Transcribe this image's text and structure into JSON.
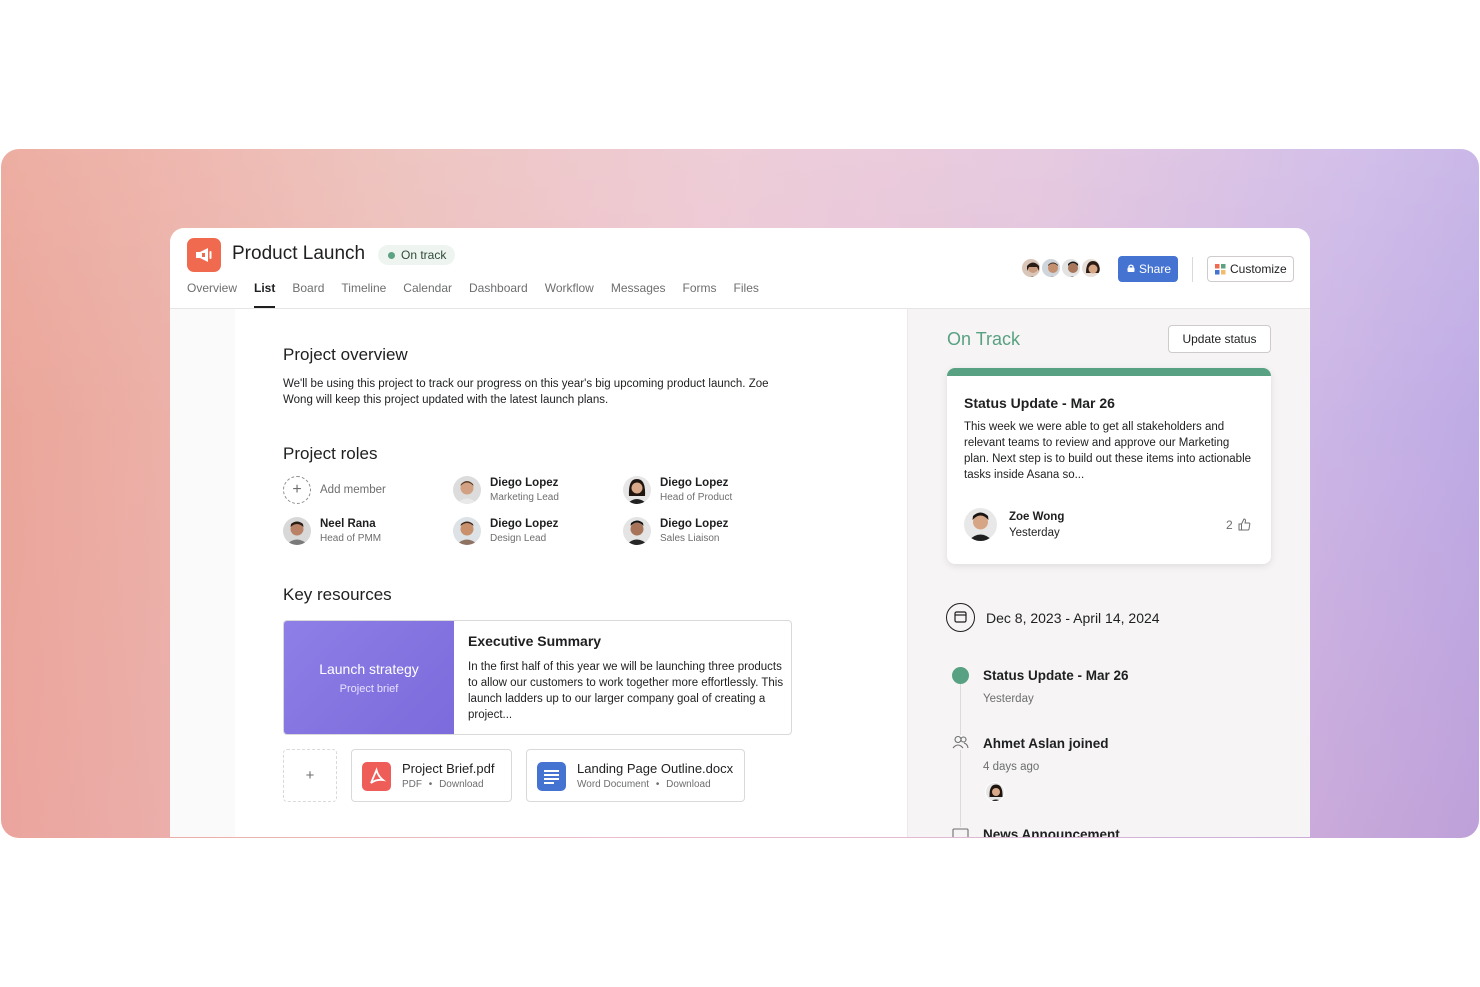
{
  "project": {
    "title": "Product Launch",
    "status": "On track",
    "icon": "megaphone-icon",
    "accent_color": "#f06a4f"
  },
  "tabs": [
    {
      "label": "Overview",
      "active": false
    },
    {
      "label": "List",
      "active": true
    },
    {
      "label": "Board",
      "active": false
    },
    {
      "label": "Timeline",
      "active": false
    },
    {
      "label": "Calendar",
      "active": false
    },
    {
      "label": "Dashboard",
      "active": false
    },
    {
      "label": "Workflow",
      "active": false
    },
    {
      "label": "Messages",
      "active": false
    },
    {
      "label": "Forms",
      "active": false
    },
    {
      "label": "Files",
      "active": false
    }
  ],
  "header": {
    "share_label": "Share",
    "customize_label": "Customize",
    "share_color": "#4573d2"
  },
  "overview": {
    "heading": "Project overview",
    "text": "We'll be using this project to track our progress on this year's big upcoming product launch. Zoe Wong will keep this project updated with the latest launch plans."
  },
  "roles": {
    "heading": "Project roles",
    "add_label": "Add member",
    "members": [
      {
        "name": "Diego Lopez",
        "role": "Marketing Lead"
      },
      {
        "name": "Diego Lopez",
        "role": "Head of Product"
      },
      {
        "name": "Neel Rana",
        "role": "Head of PMM"
      },
      {
        "name": "Diego Lopez",
        "role": "Design Lead"
      },
      {
        "name": "Diego Lopez",
        "role": "Sales Liaison"
      }
    ]
  },
  "resources": {
    "heading": "Key resources",
    "card": {
      "thumb_title": "Launch strategy",
      "thumb_sub": "Project brief",
      "title": "Executive Summary",
      "text": "In the first half of this year we will be launching three products to allow our customers to work together more effortlessly. This launch ladders up to our larger company goal of creating a project..."
    },
    "add_symbol": "+",
    "files": [
      {
        "name": "Project Brief.pdf",
        "type": "PDF",
        "action": "Download",
        "icon": "pdf-icon",
        "color": "#ef5d58"
      },
      {
        "name": "Landing Page Outline.docx",
        "type": "Word Document",
        "action": "Download",
        "icon": "doc-icon",
        "color": "#4573d2"
      }
    ],
    "separator": "•"
  },
  "side": {
    "status_heading": "On Track",
    "status_color": "#58a182",
    "update_button": "Update status",
    "card": {
      "title": "Status Update - Mar 26",
      "text": "This week we were able to get all stakeholders and relevant teams to review and approve our Marketing plan. Next step is to build out these items into actionable tasks inside Asana so...",
      "author": "Zoe Wong",
      "when": "Yesterday",
      "likes": "2"
    },
    "date_range": "Dec 8, 2023 - April 14, 2024",
    "timeline": [
      {
        "title": "Status Update - Mar 26",
        "sub": "Yesterday"
      },
      {
        "title": "Ahmet Aslan joined",
        "sub": "4 days ago"
      },
      {
        "title": "News Announcement",
        "sub": ""
      }
    ]
  }
}
